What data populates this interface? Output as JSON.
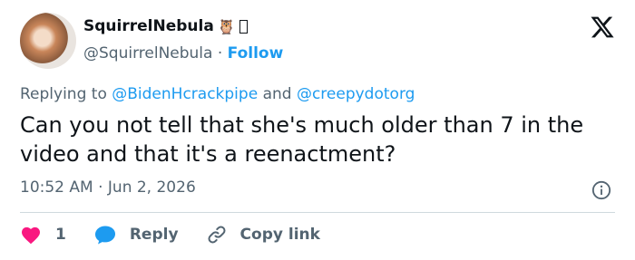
{
  "author": {
    "display_name": "SquirrelNebula",
    "emoji": "🦉",
    "handle": "@SquirrelNebula",
    "separator": "·",
    "follow_label": "Follow"
  },
  "replying": {
    "prefix": "Replying to",
    "mention1": "@BidenHcrackpipe",
    "conjunction": "and",
    "mention2": "@creepydotorg"
  },
  "tweet_text": "Can you not tell that she's much older than 7 in the video and that it's a reenactment?",
  "timestamp": "10:52 AM · Jun 2, 2026",
  "actions": {
    "like_count": "1",
    "reply_label": "Reply",
    "copy_link_label": "Copy link"
  },
  "icons": {
    "brand": "x-logo-icon",
    "info": "info-icon",
    "like": "heart-icon",
    "reply": "reply-bubble-icon",
    "copy": "link-icon"
  },
  "colors": {
    "link": "#1d9bf0",
    "secondary_text": "#536471",
    "heart": "#f91880"
  }
}
